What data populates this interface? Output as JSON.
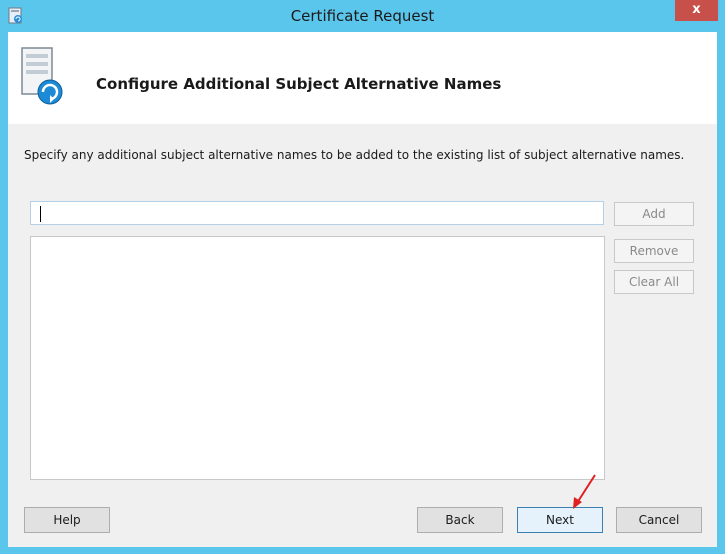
{
  "window": {
    "title": "Certificate Request",
    "close_label": "x"
  },
  "header": {
    "title": "Configure Additional Subject Alternative Names"
  },
  "description": "Specify any additional subject alternative names to be added to the existing list of subject alternative names.",
  "san_input": {
    "value": "",
    "placeholder": ""
  },
  "side_buttons": {
    "add": "Add",
    "remove": "Remove",
    "clear_all": "Clear All"
  },
  "footer_buttons": {
    "help": "Help",
    "back": "Back",
    "next": "Next",
    "cancel": "Cancel"
  },
  "colors": {
    "titlebar": "#5bc6ec",
    "close": "#c7504b",
    "annotation_arrow": "#e02020"
  }
}
